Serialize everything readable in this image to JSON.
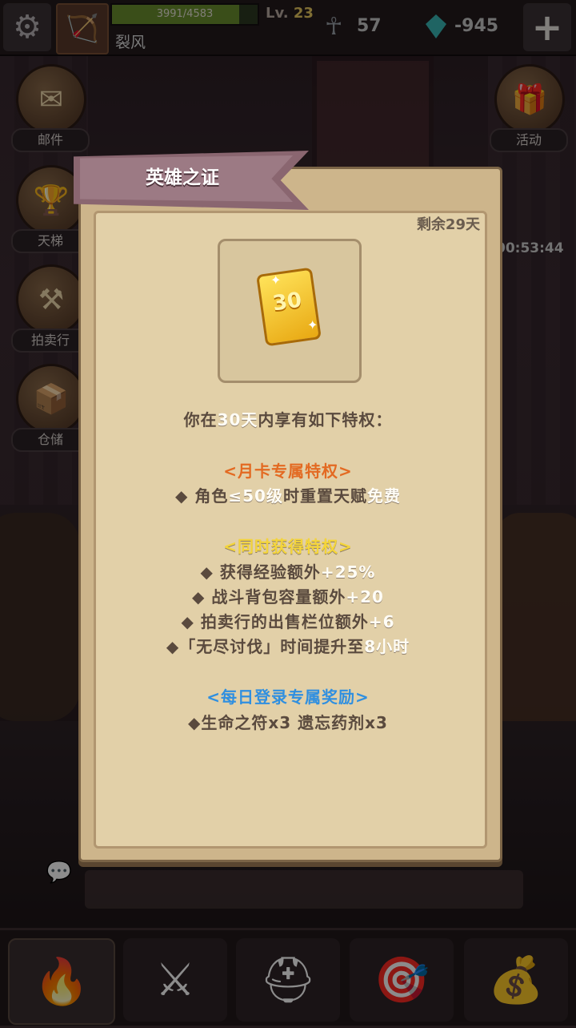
{
  "topbar": {
    "xp_text": "3991/4583",
    "xp_fraction": 0.871,
    "level_prefix": "Lv.",
    "level_value": "23",
    "player_name": "裂风",
    "ankh_count": "57",
    "gem_count": "-945"
  },
  "side_left": [
    {
      "label": "邮件",
      "icon": "mail-icon"
    },
    {
      "label": "天梯",
      "icon": "ladder-icon"
    },
    {
      "label": "拍卖行",
      "icon": "auction-icon"
    },
    {
      "label": "仓储",
      "icon": "storage-icon"
    }
  ],
  "side_right": [
    {
      "label": "活动",
      "icon": "gift-icon"
    }
  ],
  "timer": "00:53:44",
  "dialog": {
    "title": "英雄之证",
    "remaining": "剩余29天",
    "card_number": "30",
    "intro": {
      "pre": "你在",
      "days": "30天",
      "post": "内享有如下特权："
    },
    "section1_title": "<月卡专属特权>",
    "s1_line": {
      "pre": "◆ 角色",
      "hl": "≤50级",
      "mid": "时重置天赋",
      "end": "免费"
    },
    "section2_title": "<同时获得特权>",
    "s2_lines": [
      {
        "pre": "◆ 获得经验额外",
        "hl": "+25%"
      },
      {
        "pre": "◆ 战斗背包容量额外",
        "hl": "+20"
      },
      {
        "pre": "◆ 拍卖行的出售栏位额外",
        "hl": "+6"
      },
      {
        "pre": "◆「无尽讨伐」时间提升至",
        "hl": "8小时"
      }
    ],
    "section3_title": "<每日登录专属奖励>",
    "s3_line": "◆生命之符x3 遗忘药剂x3"
  },
  "bottom_nav": [
    "campfire-icon",
    "battle-swords-icon",
    "helmet-icon",
    "target-icon",
    "treasure-chest-icon"
  ],
  "colors": {
    "orange": "#e36a22",
    "yellow": "#f4d53a",
    "blue": "#2f8fe0",
    "parchment": "#e2d0a8"
  }
}
